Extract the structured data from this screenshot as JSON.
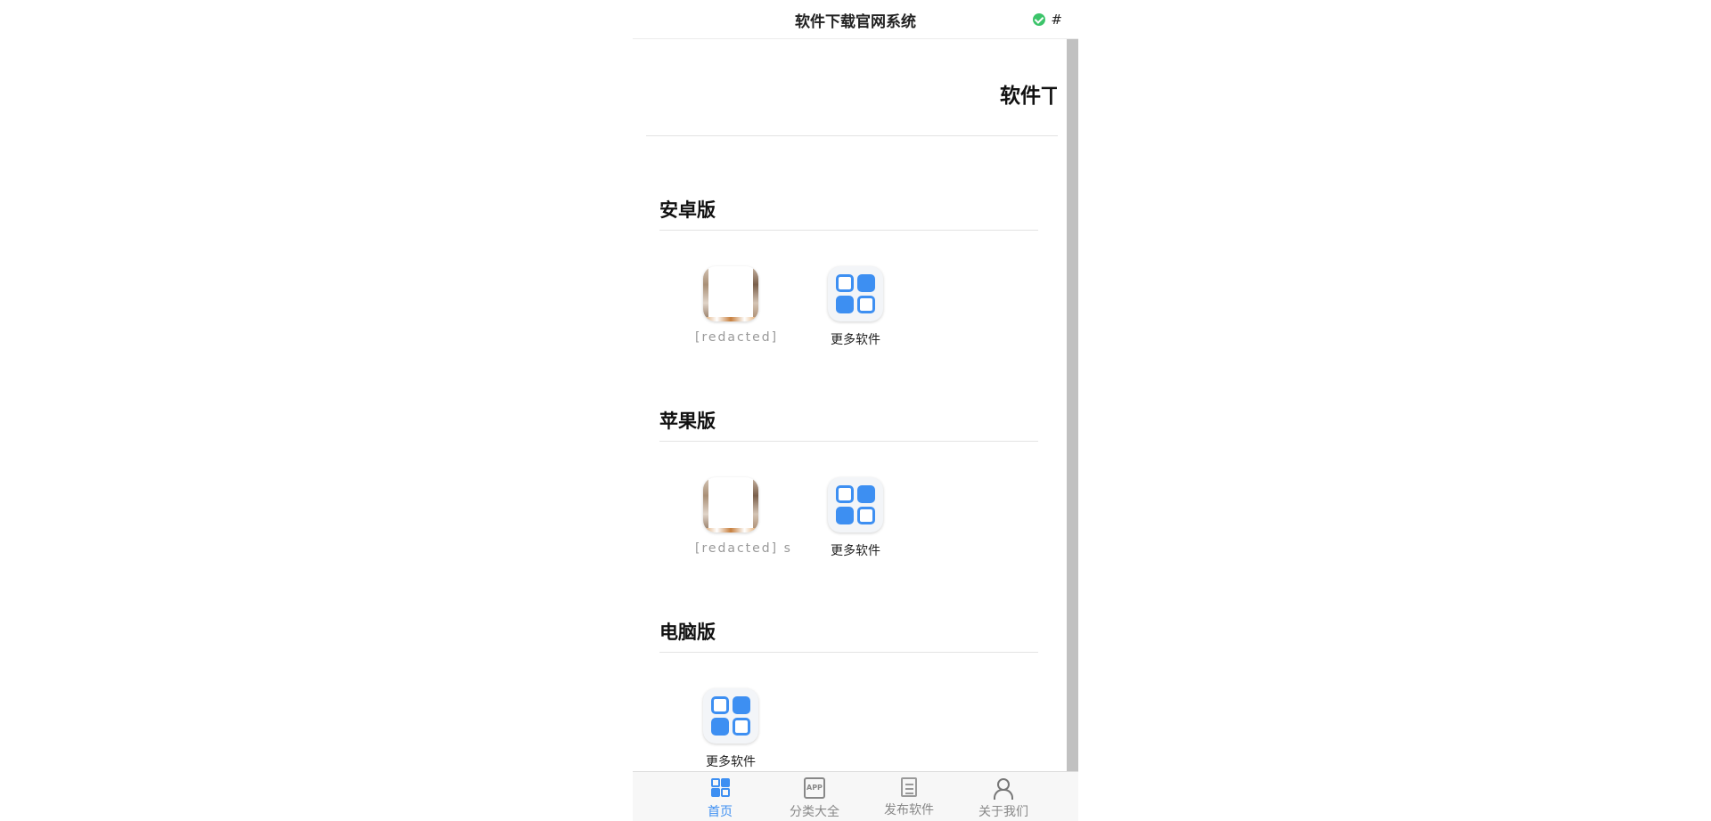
{
  "header": {
    "title": "软件下载官网系统",
    "status_icon": "check-circle-icon",
    "status_color": "#3cc46a",
    "hash_text": "#"
  },
  "banner": {
    "title_visible": "软件丅"
  },
  "sections": [
    {
      "title": "安卓版",
      "apps": [
        {
          "label": "[redacted]",
          "icon": "app-photo-icon"
        },
        {
          "label": "更多软件",
          "icon": "more-apps-grid-icon"
        }
      ]
    },
    {
      "title": "苹果版",
      "apps": [
        {
          "label": "[redacted] s",
          "icon": "app-photo-icon"
        },
        {
          "label": "更多软件",
          "icon": "more-apps-grid-icon"
        }
      ]
    },
    {
      "title": "电脑版",
      "apps": [
        {
          "label": "更多软件",
          "icon": "more-apps-grid-icon"
        }
      ]
    }
  ],
  "tabbar": {
    "active_color": "#3d8ff2",
    "items": [
      {
        "label": "首页",
        "icon": "home-grid-icon",
        "active": true
      },
      {
        "label": "分类大全",
        "icon": "app-category-icon",
        "active": false
      },
      {
        "label": "发布软件",
        "icon": "document-icon",
        "active": false
      },
      {
        "label": "关于我们",
        "icon": "users-icon",
        "active": false
      }
    ]
  }
}
